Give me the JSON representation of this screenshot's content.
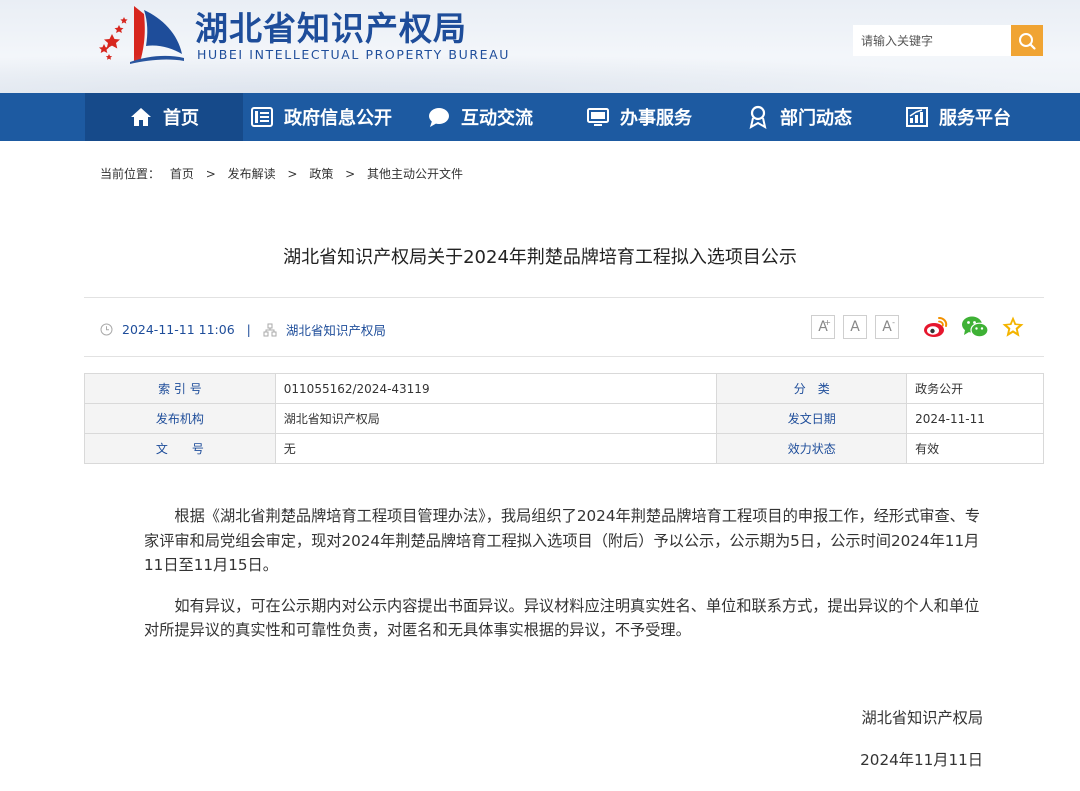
{
  "header": {
    "title": "湖北省知识产权局",
    "subtitle": "HUBEI INTELLECTUAL PROPERTY BUREAU",
    "search_placeholder": "请输入关键字",
    "logo_icon": "stars-and-sail-logo",
    "search_icon": "search-icon"
  },
  "colors": {
    "brand_blue": "#1d5aa1",
    "active_nav": "#164a8a",
    "search_button": "#f0a433",
    "logo_red": "#d7261e"
  },
  "nav": {
    "items": [
      {
        "label": "首页",
        "icon": "home-icon"
      },
      {
        "label": "政府信息公开",
        "icon": "list-icon"
      },
      {
        "label": "互动交流",
        "icon": "chat-icon"
      },
      {
        "label": "办事服务",
        "icon": "monitor-icon"
      },
      {
        "label": "部门动态",
        "icon": "location-icon"
      },
      {
        "label": "服务平台",
        "icon": "chart-icon"
      }
    ]
  },
  "breadcrumb": {
    "prefix": "当前位置：",
    "items": [
      "首页",
      "发布解读",
      "政策",
      "其他主动公开文件"
    ],
    "separator": ">"
  },
  "article": {
    "title": "湖北省知识产权局关于2024年荆楚品牌培育工程拟入选项目公示",
    "datetime": "2024-11-11 11:06",
    "meta_separator": "|",
    "source": "湖北省知识产权局",
    "font_buttons": [
      "A+",
      "A",
      "A-"
    ],
    "font_button_base": "A",
    "share_icons": [
      "weibo-icon",
      "wechat-icon",
      "favorite-star-icon"
    ]
  },
  "info_table": {
    "rows": [
      [
        {
          "label": "索 引 号",
          "value": "011055162/2024-43119"
        },
        {
          "label": "分　类",
          "value": "政务公开"
        }
      ],
      [
        {
          "label": "发布机构",
          "value": "湖北省知识产权局"
        },
        {
          "label": "发文日期",
          "value": "2024-11-11"
        }
      ],
      [
        {
          "label": "文　　号",
          "value": "无"
        },
        {
          "label": "效力状态",
          "value": "有效"
        }
      ]
    ]
  },
  "content": {
    "paragraphs": [
      "根据《湖北省荆楚品牌培育工程项目管理办法》，我局组织了2024年荆楚品牌培育工程项目的申报工作，经形式审查、专家评审和局党组会审定，现对2024年荆楚品牌培育工程拟入选项目（附后）予以公示，公示期为5日，公示时间2024年11月11日至11月15日。",
      "如有异议，可在公示期内对公示内容提出书面异议。异议材料应注明真实姓名、单位和联系方式，提出异议的个人和单位对所提异议的真实性和可靠性负责，对匿名和无具体事实根据的异议，不予受理。"
    ],
    "signature": "湖北省知识产权局",
    "date": "2024年11月11日"
  }
}
